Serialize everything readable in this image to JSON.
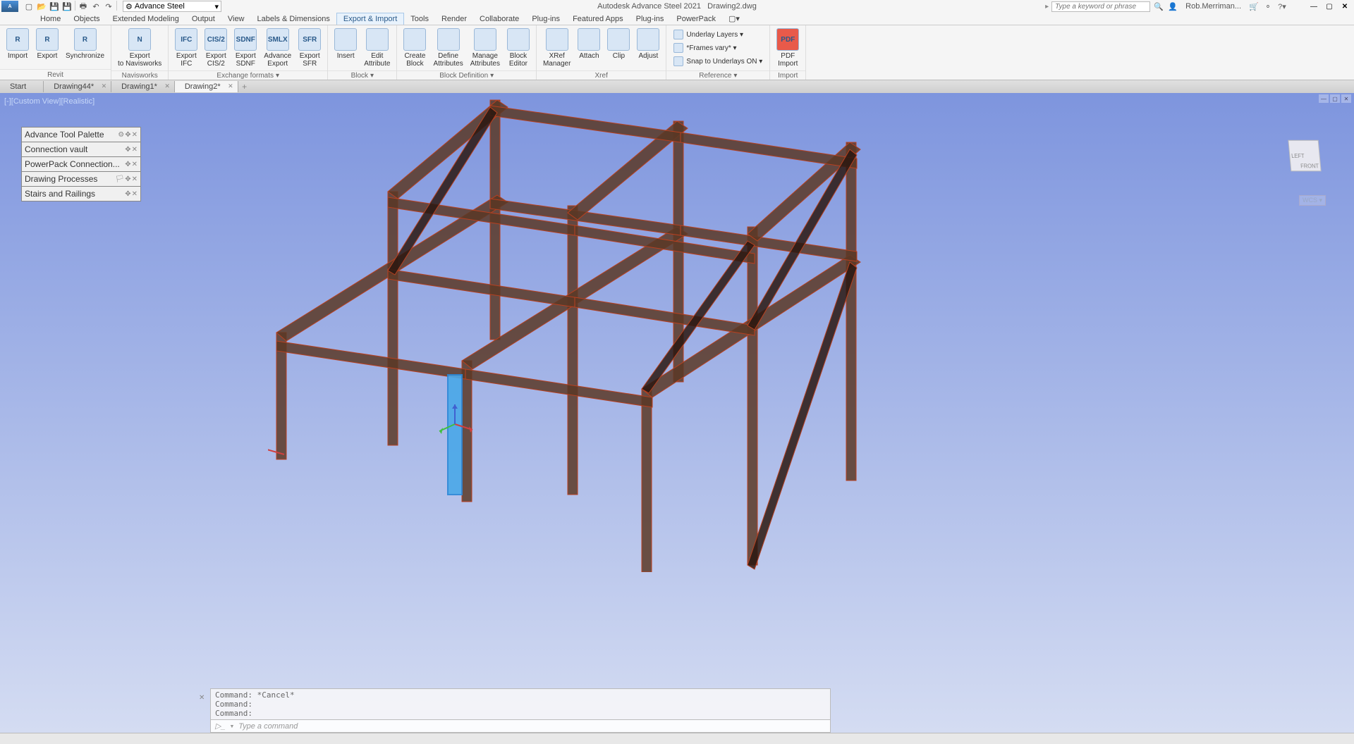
{
  "app": {
    "title_product": "Autodesk Advance Steel 2021",
    "title_file": "Drawing2.dwg",
    "workspace": "Advance Steel",
    "search_placeholder": "Type a keyword or phrase",
    "user": "Rob.Merriman..."
  },
  "qat_icons": [
    "new-icon",
    "open-icon",
    "save-icon",
    "saveas-icon",
    "print-icon",
    "undo-icon",
    "redo-icon"
  ],
  "ribbon_tabs": [
    "Home",
    "Objects",
    "Extended Modeling",
    "Output",
    "View",
    "Labels & Dimensions",
    "Export & Import",
    "Tools",
    "Render",
    "Collaborate",
    "Plug-ins",
    "Featured Apps",
    "Plug-ins",
    "PowerPack"
  ],
  "active_tab": "Export & Import",
  "panels": {
    "revit": {
      "title": "Revit",
      "items": [
        "Import",
        "Export",
        "Synchronize"
      ]
    },
    "navis": {
      "title": "Navisworks",
      "items": [
        "Export to Navisworks"
      ]
    },
    "exchange": {
      "title": "Exchange formats",
      "items": [
        "Export IFC",
        "Export CIS/2",
        "Export SDNF",
        "Advance Export",
        "Export SFR"
      ],
      "badges": [
        "IFC",
        "CIS/2",
        "SDNF",
        "SMLX",
        "SFR"
      ]
    },
    "block": {
      "title": "Block",
      "items": [
        "Insert",
        "Edit Attribute"
      ]
    },
    "blockdef": {
      "title": "Block Definition",
      "items": [
        "Create Block",
        "Define Attributes",
        "Manage Attributes",
        "Block Editor"
      ]
    },
    "xref": {
      "title": "Xref",
      "items": [
        "XRef Manager",
        "Attach",
        "Clip",
        "Adjust"
      ]
    },
    "reference": {
      "title": "Reference",
      "items": [
        "Underlay Layers",
        "*Frames vary*",
        "Snap to Underlays ON"
      ]
    },
    "import": {
      "title": "Import",
      "items": [
        "PDF Import"
      ]
    }
  },
  "file_tabs": [
    {
      "label": "Start",
      "close": false
    },
    {
      "label": "Drawing44*",
      "close": true
    },
    {
      "label": "Drawing1*",
      "close": true
    },
    {
      "label": "Drawing2*",
      "close": true,
      "active": true
    }
  ],
  "view_label": "[-][Custom View][Realistic]",
  "palettes": [
    "Advance Tool Palette",
    "Connection vault",
    "PowerPack Connection...",
    "Drawing Processes",
    "Stairs and Railings"
  ],
  "wcs": "WCS",
  "viewcube": {
    "left": "LEFT",
    "front": "FRONT"
  },
  "command": {
    "history": [
      "Command: *Cancel*",
      "Command:",
      "Command:"
    ],
    "prompt": "Type a command"
  }
}
